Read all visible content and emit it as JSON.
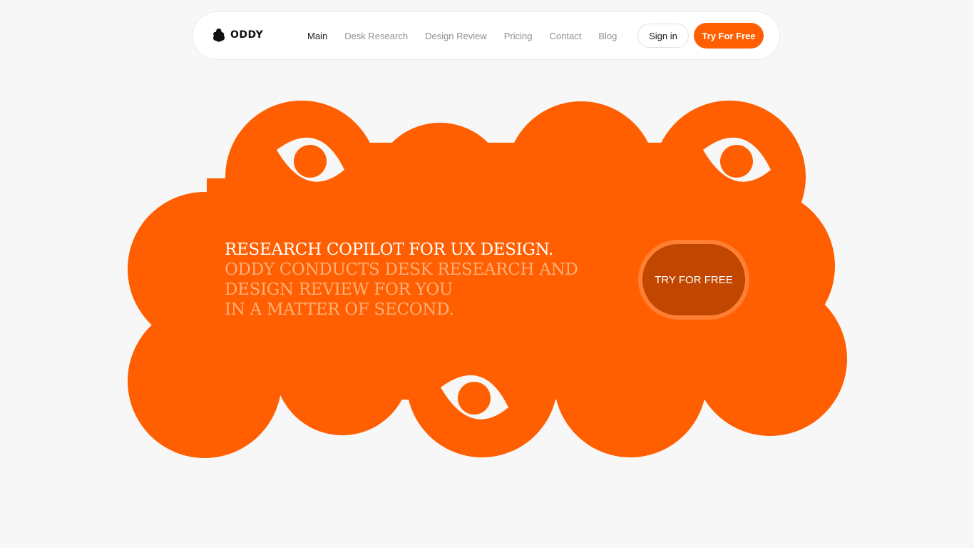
{
  "brand": {
    "name": "ODDY",
    "logo_icon": "blob-mascot-icon",
    "accent_color": "#ff5f00"
  },
  "nav": {
    "links": [
      {
        "label": "Main",
        "active": true
      },
      {
        "label": "Desk Research",
        "active": false
      },
      {
        "label": "Design Review",
        "active": false
      },
      {
        "label": "Pricing",
        "active": false
      },
      {
        "label": "Contact",
        "active": false
      },
      {
        "label": "Blog",
        "active": false
      }
    ],
    "signin_label": "Sign in",
    "try_label": "Try For Free"
  },
  "hero": {
    "title": "RESEARCH COPILOT FOR UX DESIGN.",
    "lines": [
      "ODDY CONDUCTS DESK RESEARCH AND",
      "DESIGN REVIEW FOR YOU",
      "IN A MATTER OF SECOND."
    ],
    "cta_label": "TRY FOR FREE",
    "decoration_icon": "eye-icon"
  }
}
